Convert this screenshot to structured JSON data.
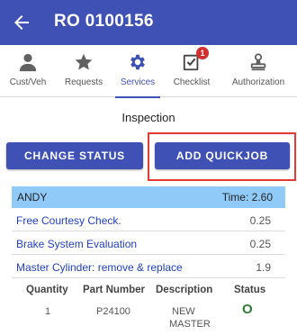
{
  "header": {
    "title": "RO 0100156",
    "back_icon": "arrow-left-icon",
    "background": "#3f51b5"
  },
  "tabs": [
    {
      "label": "Cust/Veh",
      "icon": "person-icon",
      "active": false
    },
    {
      "label": "Requests",
      "icon": "star-icon",
      "active": false
    },
    {
      "label": "Services",
      "icon": "gear-icon",
      "active": true
    },
    {
      "label": "Checklist",
      "icon": "checklist-icon",
      "active": false,
      "badge": "1"
    },
    {
      "label": "Authorization",
      "icon": "stamp-icon",
      "active": false
    }
  ],
  "section_title": "Inspection",
  "buttons": {
    "change_status": "CHANGE STATUS",
    "add_quickjob": "ADD QUICKJOB"
  },
  "job": {
    "technician": "ANDY",
    "time_label": "Time: 2.60"
  },
  "operations": [
    {
      "description": "Free Courtesy Check.",
      "hours": "0.25"
    },
    {
      "description": "Brake System Evaluation",
      "hours": "0.25"
    },
    {
      "description": "Master Cylinder: remove & replace",
      "hours": "1.9"
    }
  ],
  "parts": {
    "columns": [
      "Quantity",
      "Part Number",
      "Description",
      "Status"
    ],
    "rows": [
      {
        "quantity": "1",
        "part_number": "P24100",
        "description_line1": "NEW",
        "description_line2": "MASTER",
        "status": "O"
      }
    ]
  },
  "colors": {
    "primary": "#3f51b5",
    "job_header": "#90caf9",
    "highlight": "#e53935",
    "status_ok": "#2e7d32",
    "badge": "#d32f2f"
  }
}
